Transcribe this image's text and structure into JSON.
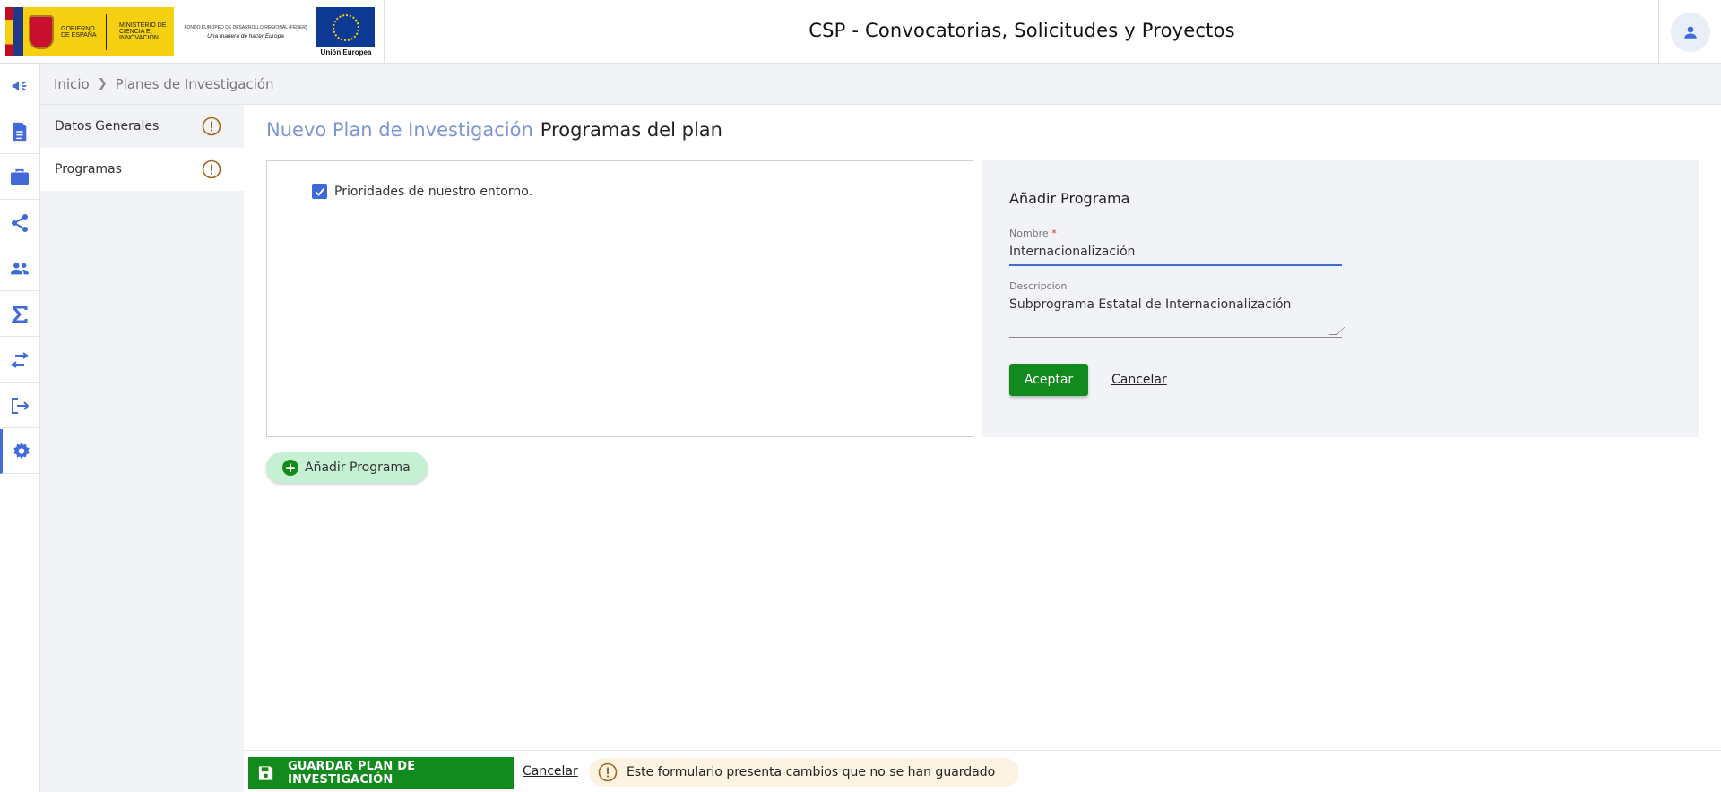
{
  "header": {
    "title": "CSP - Convocatorias, Solicitudes y Proyectos",
    "logo_gob_line1": "GOBIERNO DE ESPAÑA",
    "logo_gob_line2": "MINISTERIO DE CIENCIA E INNOVACIÓN",
    "logo_feder_line1": "FONDO EUROPEO DE DESARROLLO REGIONAL (FEDER)",
    "logo_feder_line2": "Una manera de hacer Europa",
    "logo_eu_label": "Unión Europea",
    "user_icon": "user-icon"
  },
  "rail": {
    "items": [
      {
        "icon": "megaphone-icon"
      },
      {
        "icon": "document-icon"
      },
      {
        "icon": "briefcase-icon"
      },
      {
        "icon": "share-icon"
      },
      {
        "icon": "people-icon"
      },
      {
        "icon": "sigma-icon"
      },
      {
        "icon": "swap-icon"
      },
      {
        "icon": "logout-icon"
      },
      {
        "icon": "gear-icon",
        "active": true
      }
    ]
  },
  "breadcrumb": {
    "home": "Inicio",
    "current": "Planes de Investigación"
  },
  "subnav": {
    "items": [
      {
        "label": "Datos Generales",
        "icon": "warning-icon"
      },
      {
        "label": "Programas",
        "icon": "warning-icon",
        "active": true
      }
    ]
  },
  "main": {
    "title_entity": "Nuevo Plan de Investigación",
    "title_section": "Programas del plan",
    "tree": {
      "items": [
        {
          "label": "Prioridades de nuestro entorno.",
          "checked": true
        }
      ]
    },
    "add_button": "Añadir Programa"
  },
  "form": {
    "title": "Añadir Programa",
    "name_label": "Nombre",
    "name_required": "*",
    "name_value": "Internacionalización",
    "desc_label": "Descripcion",
    "desc_value": "Subprograma Estatal de Internacionalización",
    "accept": "Aceptar",
    "cancel": "Cancelar"
  },
  "footer": {
    "save": "GUARDAR PLAN DE INVESTIGACIÓN",
    "cancel": "Cancelar",
    "unsaved_message": "Este formulario presenta cambios que no se han guardado"
  },
  "colors": {
    "accent": "#3f6ad8",
    "title_accent": "#7c95d4",
    "success": "#138a1e",
    "warning": "#a0661a",
    "panel_bg": "#f1f3f6"
  }
}
